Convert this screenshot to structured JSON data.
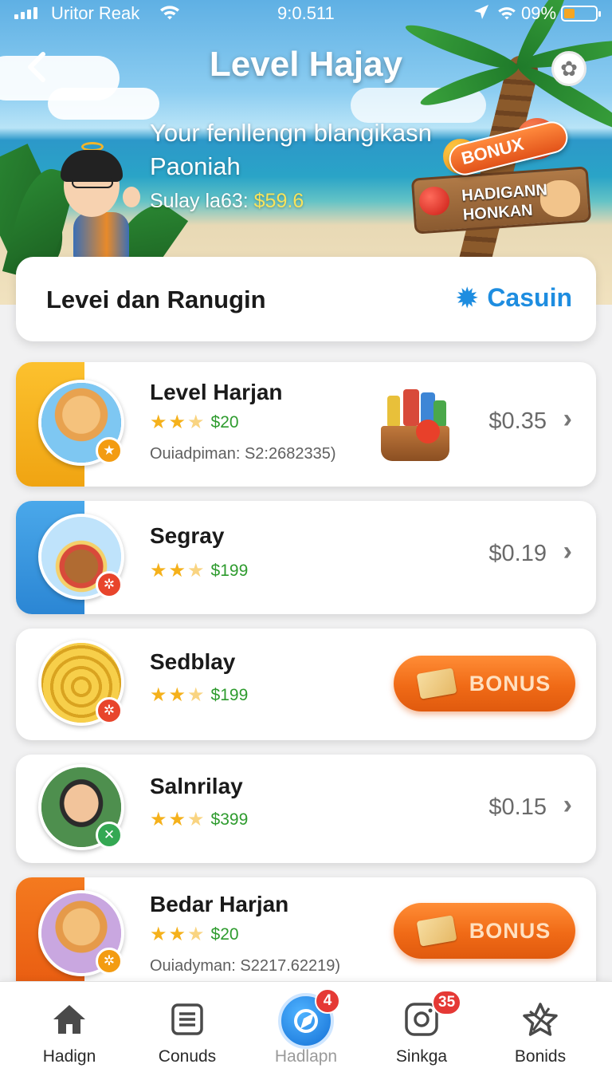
{
  "status_bar": {
    "carrier": "Uritor Reak",
    "time": "9:0.511",
    "battery_percent": "09%",
    "battery_level": 0.35
  },
  "header": {
    "title": "Level Hajay",
    "subtitle": "Your fenllengn blangikasn Paoniah",
    "balance_label": "Sulay la63:",
    "balance_value": "$59.6"
  },
  "promo": {
    "ribbon": "BONUX",
    "sign_line1": "HADIGANN",
    "sign_line2": "HONKAN"
  },
  "section": {
    "title": "Levei dan Ranugin",
    "action_label": "Casuin"
  },
  "items": [
    {
      "name": "Level Harjan",
      "rating": 2.5,
      "price": "$20",
      "meta": "Ouiadpiman: S2:26​82335)",
      "amount": "$0.35",
      "action": "chevron",
      "accent": "#f7b21d",
      "badge_color": "#f39c12"
    },
    {
      "name": "Segray",
      "rating": 2.5,
      "price": "$199",
      "amount": "$0.19",
      "action": "chevron",
      "accent": "#3a9be0",
      "badge_color": "#e8452c"
    },
    {
      "name": "Sedblay",
      "rating": 2.5,
      "price": "$199",
      "action": "bonus",
      "bonus_label": "BONUS",
      "badge_color": "#e8452c"
    },
    {
      "name": "Salnrilay",
      "rating": 2.5,
      "price": "$399",
      "amount": "$0.15",
      "action": "chevron",
      "badge_color": "#34a853"
    },
    {
      "name": "Bedar Harjan",
      "rating": 2.5,
      "price": "$20",
      "meta": "Ouiadyman: S2217.62219)",
      "action": "bonus",
      "bonus_label": "BONUS",
      "accent": "#f06a16",
      "badge_color": "#f39c12"
    }
  ],
  "nav": [
    {
      "label": "Hadign",
      "icon": "home-icon"
    },
    {
      "label": "Conuds",
      "icon": "list-icon"
    },
    {
      "label": "Hadlapn",
      "icon": "compass-icon",
      "badge": "4",
      "active": true
    },
    {
      "label": "Sinkga",
      "icon": "camera-icon",
      "badge": "35"
    },
    {
      "label": "Bonids",
      "icon": "star-icon"
    }
  ]
}
